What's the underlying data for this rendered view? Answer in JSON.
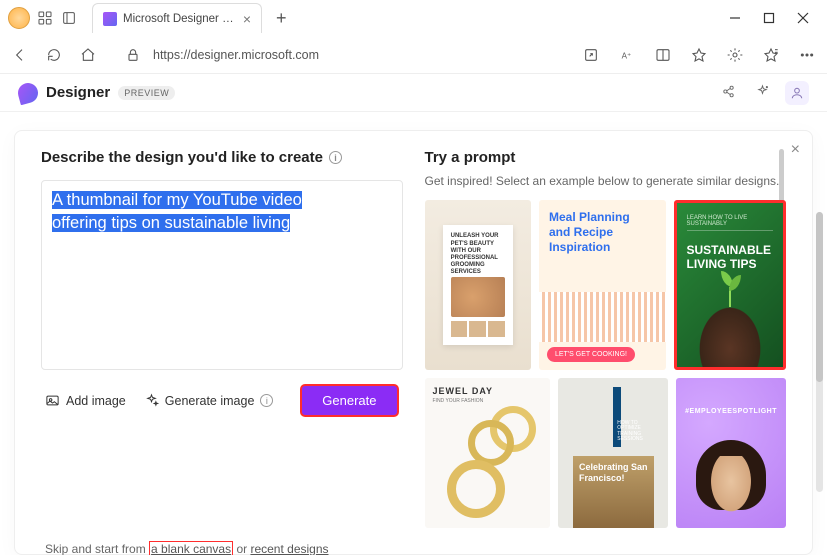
{
  "browser": {
    "tab_title": "Microsoft Designer - Stunning d",
    "url": "https://designer.microsoft.com"
  },
  "app": {
    "name": "Designer",
    "badge": "PREVIEW"
  },
  "left": {
    "heading": "Describe the design you'd like to create",
    "prompt_line1": "A thumbnail for my YouTube video",
    "prompt_line2": "offering tips on sustainable living",
    "add_image": "Add image",
    "generate_image": "Generate image",
    "generate": "Generate"
  },
  "skip": {
    "prefix": "Skip and start from ",
    "blank": "a blank canvas",
    "mid": " or ",
    "recent": "recent designs"
  },
  "right": {
    "heading": "Try a prompt",
    "sub": "Get inspired! Select an example below to generate similar designs.",
    "tile1_l1": "Meal Planning",
    "tile1_l2": "and Recipe",
    "tile1_l3": "Inspiration",
    "tile1_pill": "LET'S GET COOKING!",
    "tile2_top": "LEARN HOW TO LIVE SUSTAINABLY",
    "tile2_l1": "SUSTAINABLE",
    "tile2_l2": "LIVING TIPS",
    "tile0_h": "UNLEASH YOUR PET'S BEAUTY WITH OUR PROFESSIONAL GROOMING SERVICES",
    "tile3": "JEWEL DAY",
    "tile3_sub": "FIND YOUR FASHION",
    "tile4_poster": "HOW TO OPTIMIZE TRAINING SESSIONS",
    "tile4_l1": "Celebrating San",
    "tile4_l2": "Francisco!",
    "tile5": "#EMPLOYEESPOTLIGHT"
  }
}
